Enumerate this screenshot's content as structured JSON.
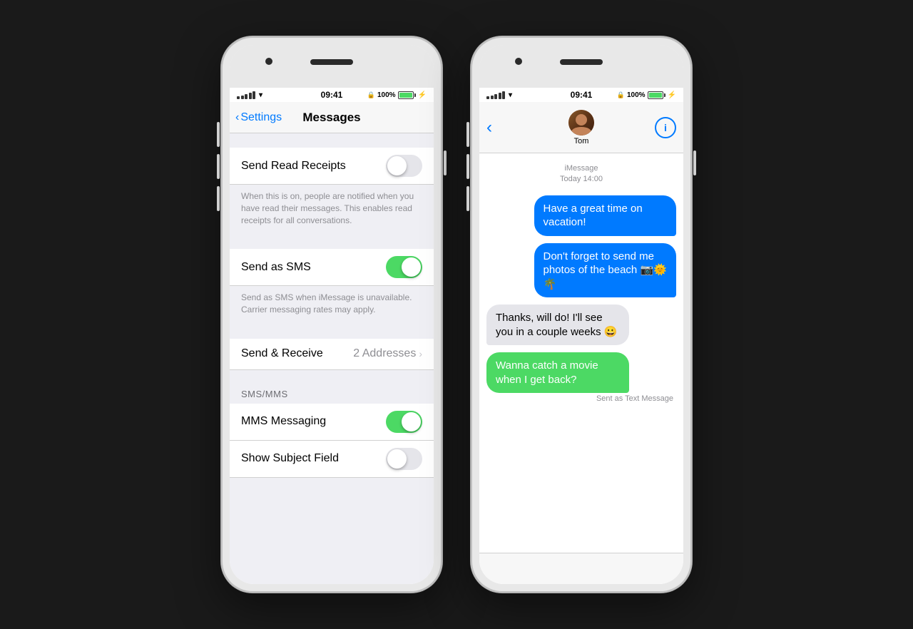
{
  "phones": {
    "left": {
      "statusBar": {
        "time": "09:41",
        "battery": "100%"
      },
      "navBar": {
        "backLabel": "Settings",
        "title": "Messages"
      },
      "settings": {
        "rows": [
          {
            "label": "Send Read Receipts",
            "toggle": "off",
            "description": "When this is on, people are notified when you have read their messages. This enables read receipts for all conversations."
          },
          {
            "label": "Send as SMS",
            "toggle": "on",
            "description": "Send as SMS when iMessage is unavailable. Carrier messaging rates may apply."
          },
          {
            "label": "Send & Receive",
            "value": "2 Addresses",
            "toggle": null
          }
        ],
        "section": "SMS/MMS",
        "sectionRows": [
          {
            "label": "MMS Messaging",
            "toggle": "on"
          },
          {
            "label": "Show Subject Field",
            "toggle": "off"
          }
        ]
      }
    },
    "right": {
      "statusBar": {
        "time": "09:41",
        "battery": "100%"
      },
      "contact": {
        "name": "Tom"
      },
      "messages": {
        "timestamp": "iMessage\nToday 14:00",
        "bubbles": [
          {
            "text": "Have a great time on vacation!",
            "type": "sent",
            "color": "blue"
          },
          {
            "text": "Don't forget to send me photos of the beach 📷🌞🌴",
            "type": "sent",
            "color": "blue"
          },
          {
            "text": "Thanks, will do! I'll see you in a couple weeks 😀",
            "type": "received",
            "color": "gray"
          },
          {
            "text": "Wanna catch a movie when I get back?",
            "type": "sent",
            "color": "green",
            "sentAs": "Sent as Text Message"
          }
        ]
      }
    }
  }
}
